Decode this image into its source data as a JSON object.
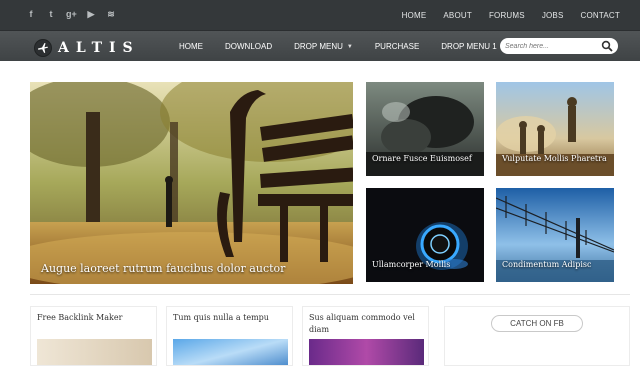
{
  "topbar": {
    "social": [
      {
        "name": "facebook-icon",
        "glyph": "f"
      },
      {
        "name": "twitter-icon",
        "glyph": "t"
      },
      {
        "name": "googleplus-icon",
        "glyph": "g+"
      },
      {
        "name": "youtube-icon",
        "glyph": "▶"
      },
      {
        "name": "rss-icon",
        "glyph": "≋"
      }
    ],
    "links": [
      "HOME",
      "ABOUT",
      "FORUMS",
      "JOBS",
      "CONTACT"
    ]
  },
  "header": {
    "logo_text": "ALTIS",
    "nav": [
      {
        "label": "HOME",
        "dropdown": false
      },
      {
        "label": "DOWNLOAD",
        "dropdown": false
      },
      {
        "label": "DROP MENU",
        "dropdown": true
      },
      {
        "label": "PURCHASE",
        "dropdown": false
      },
      {
        "label": "DROP MENU 1",
        "dropdown": true
      }
    ],
    "search_placeholder": "Search here..."
  },
  "featured": {
    "main_caption": "Augue laoreet rutrum faucibus dolor auctor",
    "tiles": [
      "Ornare Fusce Euismosef",
      "Vulputate Mollis Pharetra",
      "Ullamcorper Mollis",
      "Condimentum Adipisc"
    ]
  },
  "cards": [
    "Free Backlink Maker",
    "Tum quis nulla a tempu",
    "Sus aliquam commodo vel diam"
  ],
  "sidebar": {
    "catch_label": "CATCH ON FB"
  },
  "colors": {
    "topbar": "#34383a",
    "navbar": "#474b4d"
  }
}
